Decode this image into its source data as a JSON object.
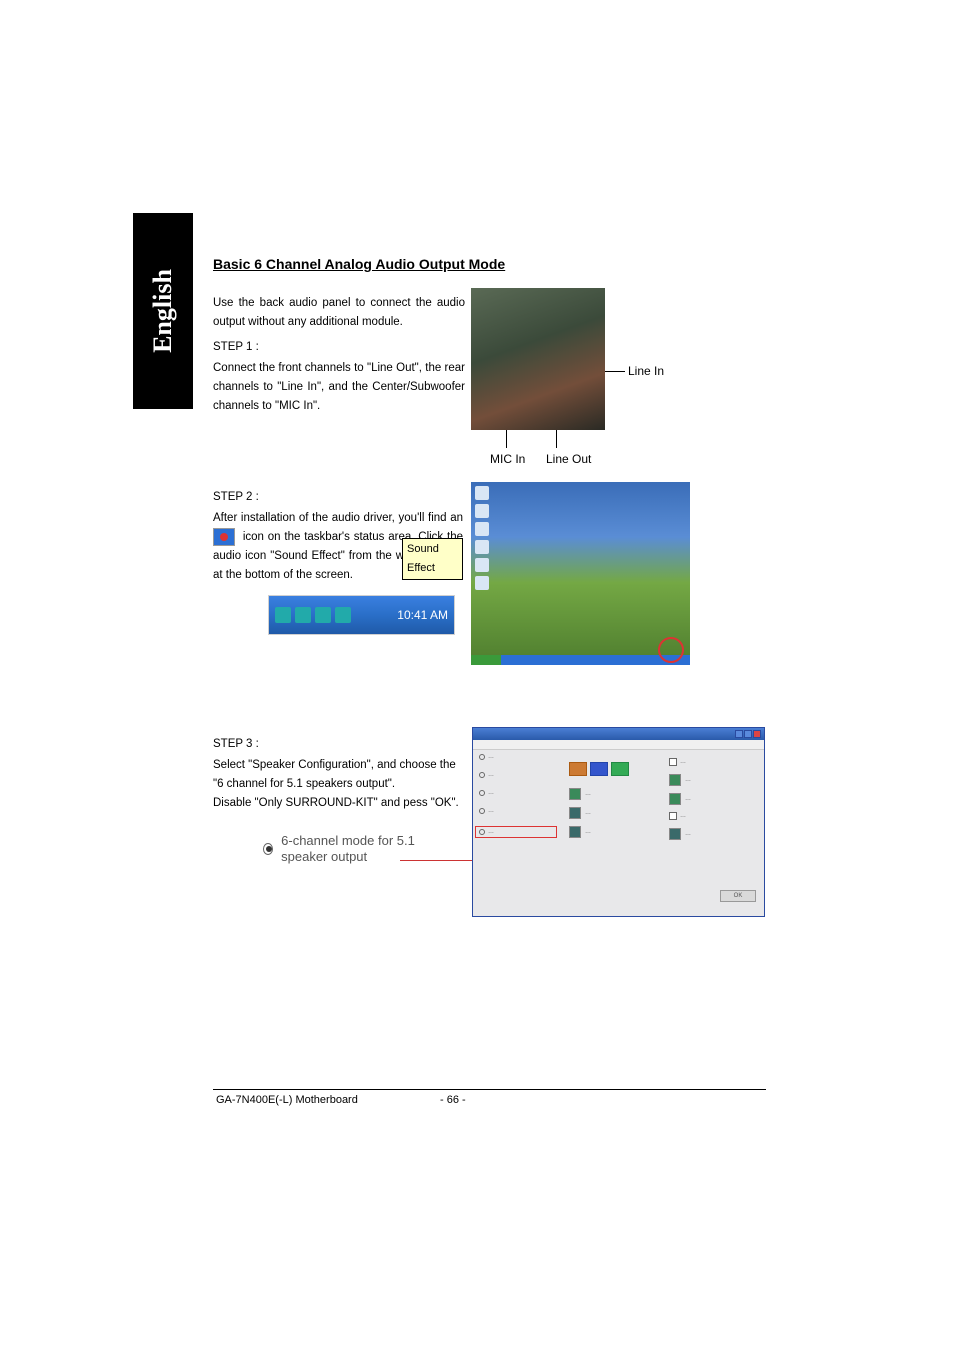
{
  "tab_label": "English",
  "heading": "Basic 6 Channel Analog Audio Output Mode",
  "intro": "Use the back audio panel to connect the audio output without any additional module.",
  "step1_label": "STEP 1 :",
  "step1_body": "Connect the front channels to \"Line Out\", the rear channels to \"Line In\", and the Center/Subwoofer channels to \"MIC In\".",
  "labels": {
    "line_in": "Line In",
    "mic_in": "MIC In",
    "line_out": "Line Out"
  },
  "step2_label": "STEP 2 :",
  "step2_body_a": "After installation of the audio driver, you'll find an",
  "step2_body_b": "icon on the taskbar's status area. Click the audio icon \"Sound Effect\" from the windows tray at the bottom of the screen.",
  "tray_tooltip": "Sound Effect",
  "tray_time": "10:41 AM",
  "step3_label": "STEP 3 :",
  "step3_line1": "Select \"Speaker Configuration\", and choose the",
  "step3_line2": "\"6 channel for 5.1 speakers output\".",
  "step3_line3": "Disable \"Only SURROUND-KIT\" and pess \"OK\".",
  "option_label": "6-channel mode for 5.1 speaker output",
  "dialog_ok": "OK",
  "footer_left": "GA-7N400E(-L) Motherboard",
  "footer_center": "- 66 -"
}
